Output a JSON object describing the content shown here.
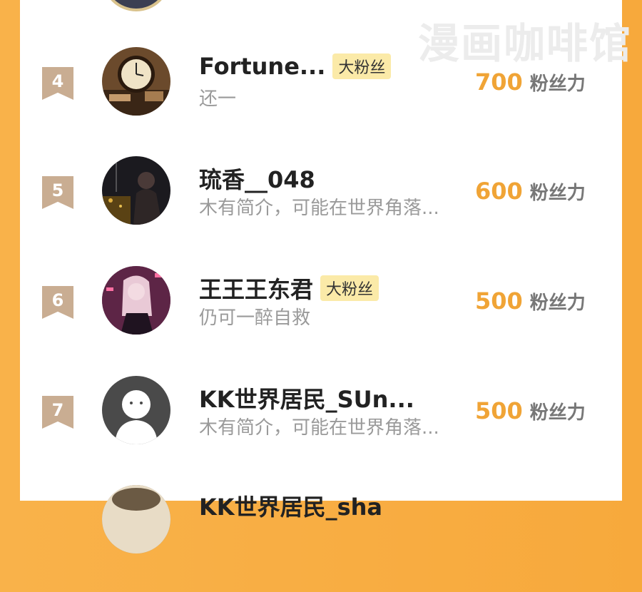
{
  "watermark": "漫画咖啡馆",
  "colors": {
    "accent": "#f0a436",
    "rank_badge": "#c9ad92",
    "fan_badge_bg": "#fbeaa8"
  },
  "score_unit": "粉丝力",
  "rows": [
    {
      "rank": "4",
      "name": "Fortune...",
      "badge": "大粉丝",
      "bio": "还一",
      "score": "700",
      "avatar_icon": "clock-photo-avatar"
    },
    {
      "rank": "5",
      "name": "琉香__048",
      "badge": "",
      "bio": "木有简介，可能在世界角落...",
      "score": "600",
      "avatar_icon": "night-photo-avatar"
    },
    {
      "rank": "6",
      "name": "王王王东君",
      "badge": "大粉丝",
      "bio": "仍可一醉自救",
      "score": "500",
      "avatar_icon": "anime-girl-avatar"
    },
    {
      "rank": "7",
      "name": "KK世界居民_SUn...",
      "badge": "",
      "bio": "木有简介，可能在世界角落...",
      "score": "500",
      "avatar_icon": "default-ghost-avatar"
    },
    {
      "rank": "",
      "name": "KK世界居民_sha",
      "badge": "",
      "bio": "",
      "score": "",
      "avatar_icon": "bear-avatar"
    }
  ]
}
